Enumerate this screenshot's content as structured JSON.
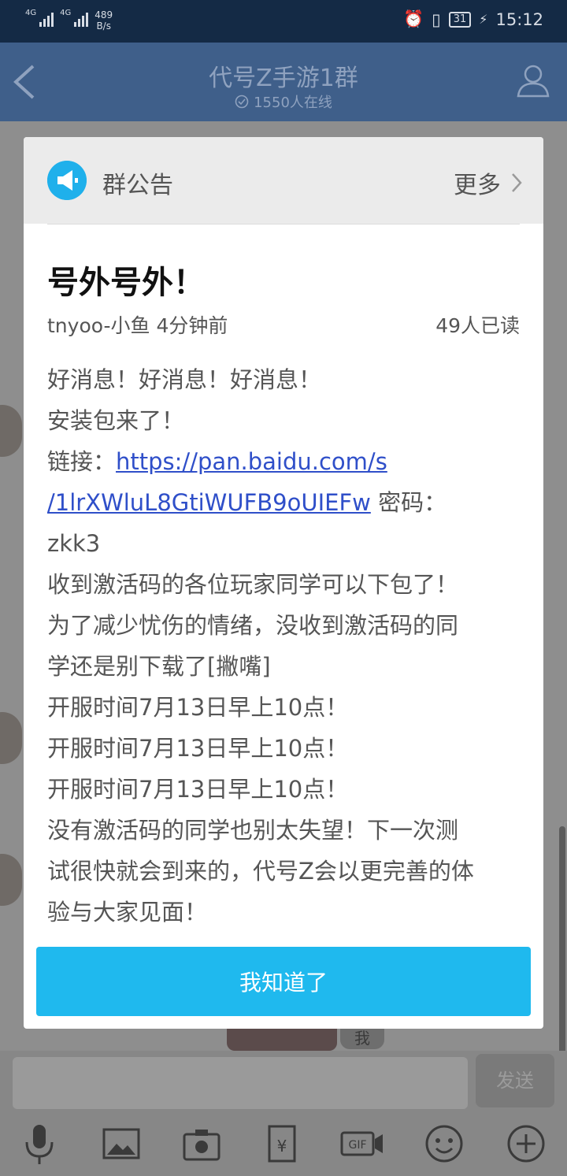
{
  "status_bar": {
    "network1": "4G",
    "network2": "4G",
    "speed_value": "489",
    "speed_unit": "B/s",
    "battery": "31",
    "time": "15:12"
  },
  "header": {
    "title": "代号Z手游1群",
    "online": "1550人在线"
  },
  "dialog": {
    "head_title": "群公告",
    "more_label": "更多",
    "announcement_title": "号外号外！",
    "author_time": "tnyoo-小鱼 4分钟前",
    "read_count": "49人已读",
    "body": {
      "l1": "好消息！好消息！好消息！",
      "l2": "安装包来了！",
      "l3_prefix": "链接：",
      "link1": "https://pan.baidu.com/s",
      "link2": "/1lrXWluL8GtiWUFB9oUIEFw",
      "l4_suffix": " 密码：",
      "l5": "zkk3",
      "l6": "收到激活码的各位玩家同学可以下包了！",
      "l7": "为了减少忧伤的情绪，没收到激活码的同",
      "l8": "学还是别下载了[撇嘴]",
      "l9": "开服时间7月13日早上10点！",
      "l10": "开服时间7月13日早上10点！",
      "l11": "开服时间7月13日早上10点！",
      "l12": "没有激活码的同学也别太失望！下一次测",
      "l13": "试很快就会到来的，代号Z会以更完善的体",
      "l14": "验与大家见面！"
    },
    "ok_button": "我知道了"
  },
  "chat": {
    "me_tag": "我"
  },
  "input": {
    "send_label": "发送",
    "tools": [
      "microphone-icon",
      "image-icon",
      "camera-icon",
      "red-packet-icon",
      "gif-icon",
      "emoji-icon",
      "plus-icon"
    ]
  },
  "colors": {
    "accent": "#1fb9ee",
    "link": "#2f4fc9",
    "header_bg": "#3f5f8a",
    "status_bg": "#142a45"
  }
}
